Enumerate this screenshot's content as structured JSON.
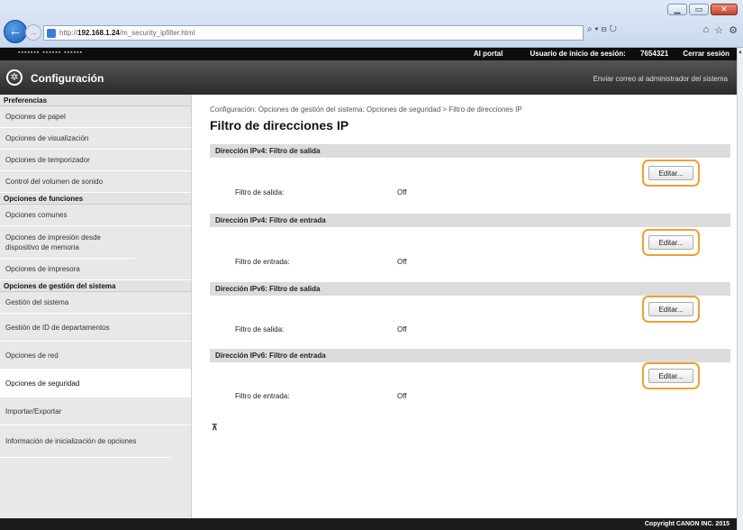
{
  "browser": {
    "url_prefix": "http://",
    "url_host": "192.168.1.24",
    "url_path": "/m_security_ipfilter.html",
    "search_controls": "⌕ ▾ ⊟ ↻",
    "win_minimize": "▁",
    "win_maximize": "▭",
    "win_close": "✕",
    "back_glyph": "←",
    "forward_glyph": "→",
    "toolbar_icons": [
      "home-icon",
      "star-icon",
      "gear-icon"
    ]
  },
  "top_strip": {
    "device_name": "▪▪▪▪▪▪▪   ▪▪▪▪▪▪ ▪▪▪▪▪▪",
    "portal": "Al portal",
    "user_label": "Usuario de inicio de sesión:",
    "user_value": "7654321",
    "logout": "Cerrar sesión"
  },
  "header": {
    "title": "Configuración",
    "email_admin": "Enviar correo al administrador del sistema"
  },
  "sidebar": {
    "groups": [
      {
        "title": "Preferencias",
        "items": [
          {
            "label": "Opciones de papel"
          },
          {
            "label": "Opciones de visualización"
          },
          {
            "label": "Opciones de temporizador"
          },
          {
            "label": "Control del volumen de sonido"
          }
        ]
      },
      {
        "title": "Opciones de funciones",
        "items": [
          {
            "label": "Opciones comunes"
          },
          {
            "label": "Opciones de impresión desde dispositivo de memoria"
          },
          {
            "label": "Opciones de impresora"
          }
        ]
      },
      {
        "title": "Opciones de gestión del sistema",
        "items": [
          {
            "label": "Gestión del sistema"
          },
          {
            "label": "Gestión de ID de departamentos"
          },
          {
            "label": "Opciones de red"
          },
          {
            "label": "Opciones de seguridad",
            "active": true
          },
          {
            "label": "Importar/Exportar"
          },
          {
            "label": "Información de inicialización de opciones"
          }
        ]
      }
    ]
  },
  "main": {
    "breadcrumb": "Configuración: Opciones de gestión del sistema: Opciones de seguridad > Filtro de direcciones IP",
    "title": "Filtro de direcciones IP",
    "edit_label": "Editar...",
    "sections": [
      {
        "heading": "Dirección IPv4: Filtro de salida",
        "field": "Filtro de salida:",
        "value": "Off"
      },
      {
        "heading": "Dirección IPv4: Filtro de entrada",
        "field": "Filtro de entrada:",
        "value": "Off"
      },
      {
        "heading": "Dirección IPv6: Filtro de salida",
        "field": "Filtro de salida:",
        "value": "Off"
      },
      {
        "heading": "Dirección IPv6: Filtro de entrada",
        "field": "Filtro de entrada:",
        "value": "Off"
      }
    ],
    "to_top": "⊼"
  },
  "footer": {
    "copyright": "Copyright CANON INC. 2015"
  }
}
